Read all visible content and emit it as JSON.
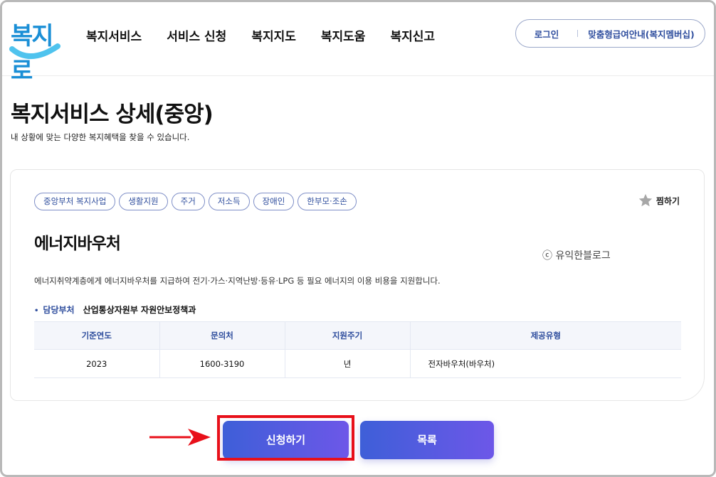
{
  "header": {
    "logo_text": "복지로",
    "nav": [
      "복지서비스",
      "서비스 신청",
      "복지지도",
      "복지도움",
      "복지신고"
    ],
    "login": "로그인",
    "member": "맞춤형급여안내(복지멤버십)"
  },
  "page": {
    "title": "복지서비스 상세(중앙)",
    "description": "내 상황에 맞는 다양한 복지혜택을 찾을 수 있습니다."
  },
  "service": {
    "tags": [
      "중앙부처 복지사업",
      "생활지원",
      "주거",
      "저소득",
      "장애인",
      "한부모·조손"
    ],
    "favorite_label": "찜하기",
    "title": "에너지바우처",
    "watermark": "ⓒ 유익한블로그",
    "description": "에너지취약계층에게 에너지바우처를 지급하여 전기·가스·지역난방·등유·LPG 등 필요 에너지의 이용 비용을 지원합니다.",
    "dept_label": "담당부처",
    "dept_value": "산업통상자원부 자원안보정책과",
    "table": {
      "headers": [
        "기준연도",
        "문의처",
        "지원주기",
        "제공유형"
      ],
      "row": [
        "2023",
        "1600-3190",
        "년",
        "전자바우처(바우처)"
      ]
    }
  },
  "actions": {
    "apply": "신청하기",
    "list": "목록"
  },
  "colors": {
    "accent": "#2e4d9d",
    "button_start": "#3e5fd8",
    "button_end": "#6d57e8",
    "highlight": "#e8101a",
    "logo": "#1b8fd6"
  },
  "icons": {
    "favorite": "star-icon",
    "pointer": "red-arrow-icon"
  }
}
